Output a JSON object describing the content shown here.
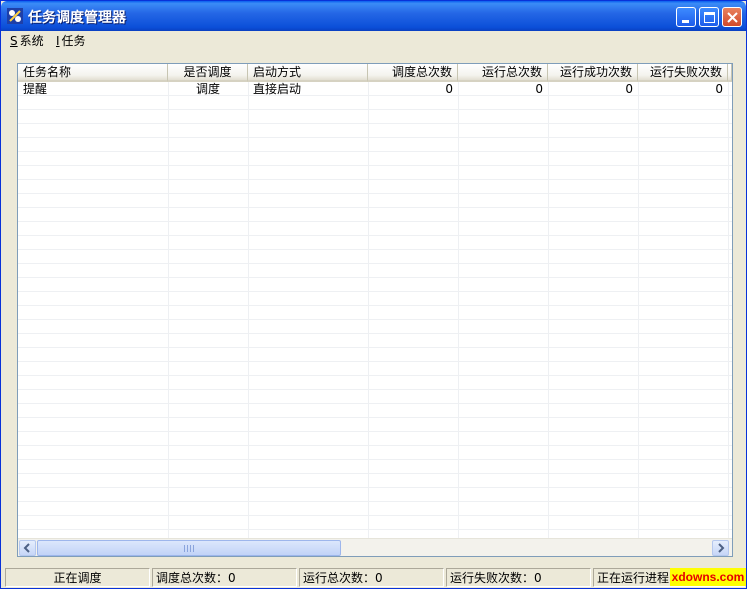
{
  "window": {
    "title": "任务调度管理器"
  },
  "menu": [
    {
      "accel": "S",
      "label": "系统"
    },
    {
      "accel": "I",
      "label": "任务"
    }
  ],
  "table": {
    "columns": [
      "任务名称",
      "是否调度",
      "启动方式",
      "调度总次数",
      "运行总次数",
      "运行成功次数",
      "运行失败次数"
    ],
    "rows": [
      [
        "提醒",
        "调度",
        "直接启动",
        "0",
        "0",
        "0",
        "0"
      ]
    ]
  },
  "scrollbar": {
    "thumb_grip": "III"
  },
  "status": [
    "正在调度",
    "调度总次数：0",
    "运行总次数：0",
    "运行失败次数：0",
    "正在运行进程"
  ],
  "watermark": "xdowns.com",
  "colors": {
    "titlebar": "#0A4FD8",
    "close": "#D1492B",
    "grid": "#EEF0F3",
    "watermark_bg": "#FFFF00",
    "watermark_text": "#E60000"
  },
  "icons": [
    "app-icon",
    "minimize-icon",
    "maximize-icon",
    "close-icon",
    "arrow-left-icon",
    "arrow-right-icon"
  ]
}
